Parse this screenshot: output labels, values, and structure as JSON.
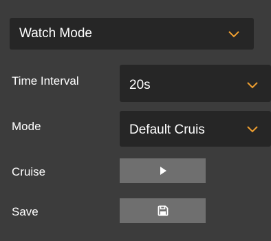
{
  "watch_mode": {
    "value": "Watch Mode"
  },
  "time_interval": {
    "label": "Time Interval",
    "value": "20s"
  },
  "mode": {
    "label": "Mode",
    "value": "Default Cruis"
  },
  "cruise": {
    "label": "Cruise",
    "button_icon": "play-icon"
  },
  "save": {
    "label": "Save",
    "button_icon": "save-icon"
  },
  "colors": {
    "panel_bg": "#3c3c3c",
    "select_bg": "#262626",
    "button_bg": "#6f6f6f",
    "accent": "#f0a030",
    "text": "#ffffff"
  }
}
